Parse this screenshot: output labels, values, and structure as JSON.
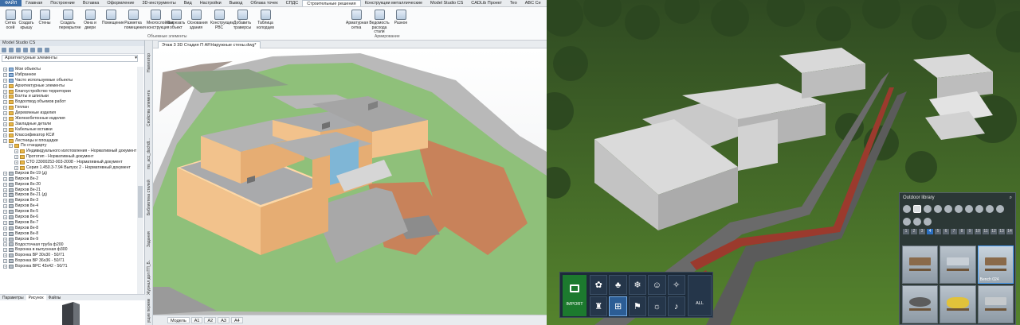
{
  "menu": {
    "file": "ФАЙЛ",
    "items": [
      "Главная",
      "Построение",
      "Вставка",
      "Оформление",
      "3D-инструменты",
      "Вид",
      "Настройки",
      "Вывод",
      "Облака точек",
      "СПДС",
      "Строительные решения",
      "Конструкции металлические",
      "Model Studio CS",
      "CADLib Проект",
      "Teo",
      "ABC Ce"
    ],
    "active_index": 10
  },
  "ribbon": {
    "buttons": [
      {
        "label": "Сетка осей",
        "icon": "grid-icon"
      },
      {
        "label": "Создать крышу",
        "icon": "roof-icon"
      },
      {
        "label": "Стены",
        "icon": "wall-icon"
      },
      {
        "label": "Создать перекрытие",
        "icon": "slab-icon"
      },
      {
        "label": "Окна и двери",
        "icon": "window-icon"
      },
      {
        "label": "Помещение",
        "icon": "room-icon"
      },
      {
        "label": "Разметка помещения",
        "icon": "room-markup-icon"
      },
      {
        "label": "Многослойная конструкция",
        "icon": "multilayer-icon"
      },
      {
        "label": "Вырезать объект",
        "icon": "cut-icon"
      },
      {
        "label": "Основания здания",
        "icon": "foundation-icon"
      },
      {
        "label": "Конструкции РВС",
        "icon": "rvs-icon"
      },
      {
        "label": "Добавить траверсы",
        "icon": "traverse-icon"
      },
      {
        "label": "Таблица колодцев",
        "icon": "wells-table-icon"
      },
      {
        "label": "Арматурная сетка",
        "icon": "rebar-mesh-icon"
      },
      {
        "label": "Ведомость расхода стали",
        "icon": "steel-sheet-icon"
      },
      {
        "label": "Разное",
        "icon": "misc-icon"
      }
    ],
    "group_objects": "Объемные элементы",
    "group_rebar": "Армирование"
  },
  "panel": {
    "title": "Model Studio CS",
    "combo": "Архитектурные элементы",
    "tree": [
      {
        "label": "Мои объекты",
        "level": 0,
        "icon": "fi blue"
      },
      {
        "label": "Избранное",
        "level": 0,
        "icon": "fi blue"
      },
      {
        "label": "Часто используемые объекты",
        "level": 0,
        "icon": "fi blue"
      },
      {
        "label": "Архитектурные элементы",
        "level": 0,
        "icon": "fi"
      },
      {
        "label": "Благоустройство территории",
        "level": 0,
        "icon": "fi"
      },
      {
        "label": "Болты и шпильки",
        "level": 0,
        "icon": "fi"
      },
      {
        "label": "Водоотвод объемов работ",
        "level": 0,
        "icon": "fi"
      },
      {
        "label": "Геплан",
        "level": 0,
        "icon": "fi"
      },
      {
        "label": "Деревянные изделия",
        "level": 0,
        "icon": "fi"
      },
      {
        "label": "Железобетонные изделия",
        "level": 0,
        "icon": "fi"
      },
      {
        "label": "Закладные детали",
        "level": 0,
        "icon": "fi"
      },
      {
        "label": "Кабельные вставки",
        "level": 0,
        "icon": "fi"
      },
      {
        "label": "Классификатор КСИ",
        "level": 0,
        "icon": "fi"
      },
      {
        "label": "Лестницы и площадки",
        "level": 0,
        "icon": "fi"
      },
      {
        "label": "По стандарту",
        "level": 1,
        "icon": "fi"
      },
      {
        "label": "Индивидуального изготовления - Нормативный документ",
        "level": 2,
        "icon": "fi"
      },
      {
        "label": "Прототип - Нормативный документ",
        "level": 2,
        "icon": "fi"
      },
      {
        "label": "СТО 23000253-003-2008 - Нормативный документ",
        "level": 2,
        "icon": "fi"
      },
      {
        "label": "Серия 1.450.3-7.94 Выпуск 2 - Нормативный документ",
        "level": 2,
        "icon": "fi"
      },
      {
        "label": "Вирхов 8н-19 (д)",
        "level": 0,
        "icon": "fi gray"
      },
      {
        "label": "Вирхов 8н-2",
        "level": 0,
        "icon": "fi gray"
      },
      {
        "label": "Вирхов 8н-20",
        "level": 0,
        "icon": "fi gray"
      },
      {
        "label": "Вирхов 8н-21",
        "level": 0,
        "icon": "fi gray"
      },
      {
        "label": "Вирхов 8н-21 (д)",
        "level": 0,
        "icon": "fi gray"
      },
      {
        "label": "Вирхов 8н-3",
        "level": 0,
        "icon": "fi gray"
      },
      {
        "label": "Вирхов 8н-4",
        "level": 0,
        "icon": "fi gray"
      },
      {
        "label": "Вирхов 8н-5",
        "level": 0,
        "icon": "fi gray"
      },
      {
        "label": "Вирхов 8н-6",
        "level": 0,
        "icon": "fi gray"
      },
      {
        "label": "Вирхов 8н-7",
        "level": 0,
        "icon": "fi gray"
      },
      {
        "label": "Вирхов 8н-8",
        "level": 0,
        "icon": "fi gray"
      },
      {
        "label": "Вирхов 8н-8",
        "level": 0,
        "icon": "fi gray"
      },
      {
        "label": "Вирхов 8н-9",
        "level": 0,
        "icon": "fi gray"
      },
      {
        "label": "Водосточная труба ф200",
        "level": 0,
        "icon": "fi gray"
      },
      {
        "label": "Воронка в выпускная ф300",
        "level": 0,
        "icon": "fi gray"
      },
      {
        "label": "Воронка ВР 30х30 - 50/71",
        "level": 0,
        "icon": "fi gray"
      },
      {
        "label": "Воронка ВР 36х36 - 50/71",
        "level": 0,
        "icon": "fi gray"
      },
      {
        "label": "Воронка ВРС 43х42 - 50/71",
        "level": 0,
        "icon": "fi gray"
      }
    ],
    "tabs": [
      "Параметры",
      "Рисунок",
      "Файлы"
    ],
    "active_tab": 1
  },
  "sidetabs": [
    "Навигатор",
    "Свойства элемента",
    "ms_acc_dochdt...",
    "Библиотека стилей",
    "Задания",
    "Журнал доп ГП_Б...",
    "Текущие перемен..."
  ],
  "document": {
    "tab": "Этаж 3 3D Стадия П АР.Наружные стены.dwg*"
  },
  "layouts": [
    "Модель",
    "A1",
    "A2",
    "A3",
    "A4"
  ],
  "lumion": {
    "library_title": "Outdoor library",
    "pages": [
      "1",
      "2",
      "3",
      "4",
      "5",
      "6",
      "7",
      "8",
      "9",
      "10",
      "11",
      "12",
      "13",
      "14"
    ],
    "active_page": 3,
    "selected_item": "Bench 024",
    "import": "IMPORT",
    "all": "ALL"
  }
}
